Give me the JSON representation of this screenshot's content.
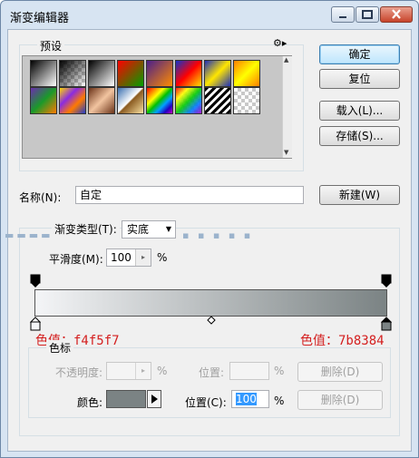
{
  "window": {
    "title": "渐变编辑器"
  },
  "presets": {
    "label": "预设",
    "row1": [
      "fg-bg",
      "fg-transparent",
      "black-white",
      "red-green",
      "violet-orange",
      "blue-red-yellow",
      "blue-yellow-blue",
      "orange-yellow-orange"
    ],
    "row2": [
      "violet-green-orange",
      "yellow-violet-orange-blue",
      "copper",
      "chrome",
      "spectrum",
      "transparent-rainbow",
      "transparent-stripes",
      "transparent"
    ]
  },
  "buttons": {
    "ok": "确定",
    "reset": "复位",
    "load": "载入(L)...",
    "save": "存储(S)...",
    "new": "新建(W)"
  },
  "name": {
    "label": "名称(N):",
    "value": "自定"
  },
  "gradient_type": {
    "label": "渐变类型(T):",
    "value": "实底"
  },
  "smoothness": {
    "label": "平滑度(M):",
    "value": "100",
    "unit": "%"
  },
  "gradient": {
    "start_color": "#f4f5f7",
    "end_color": "#7b8384"
  },
  "annotations": {
    "left": "色值：f4f5f7",
    "right": "色值：7b8384"
  },
  "color_stops": {
    "label": "色标",
    "opacity_label": "不透明度:",
    "opacity_unit": "%",
    "opacity_location_label": "位置:",
    "opacity_location_unit": "%",
    "delete_label": "删除(D)",
    "color_label": "颜色:",
    "color_value": "#7b8384",
    "location_label": "位置(C):",
    "location_value": "100",
    "location_unit": "%",
    "delete_label_2": "删除(D)"
  }
}
